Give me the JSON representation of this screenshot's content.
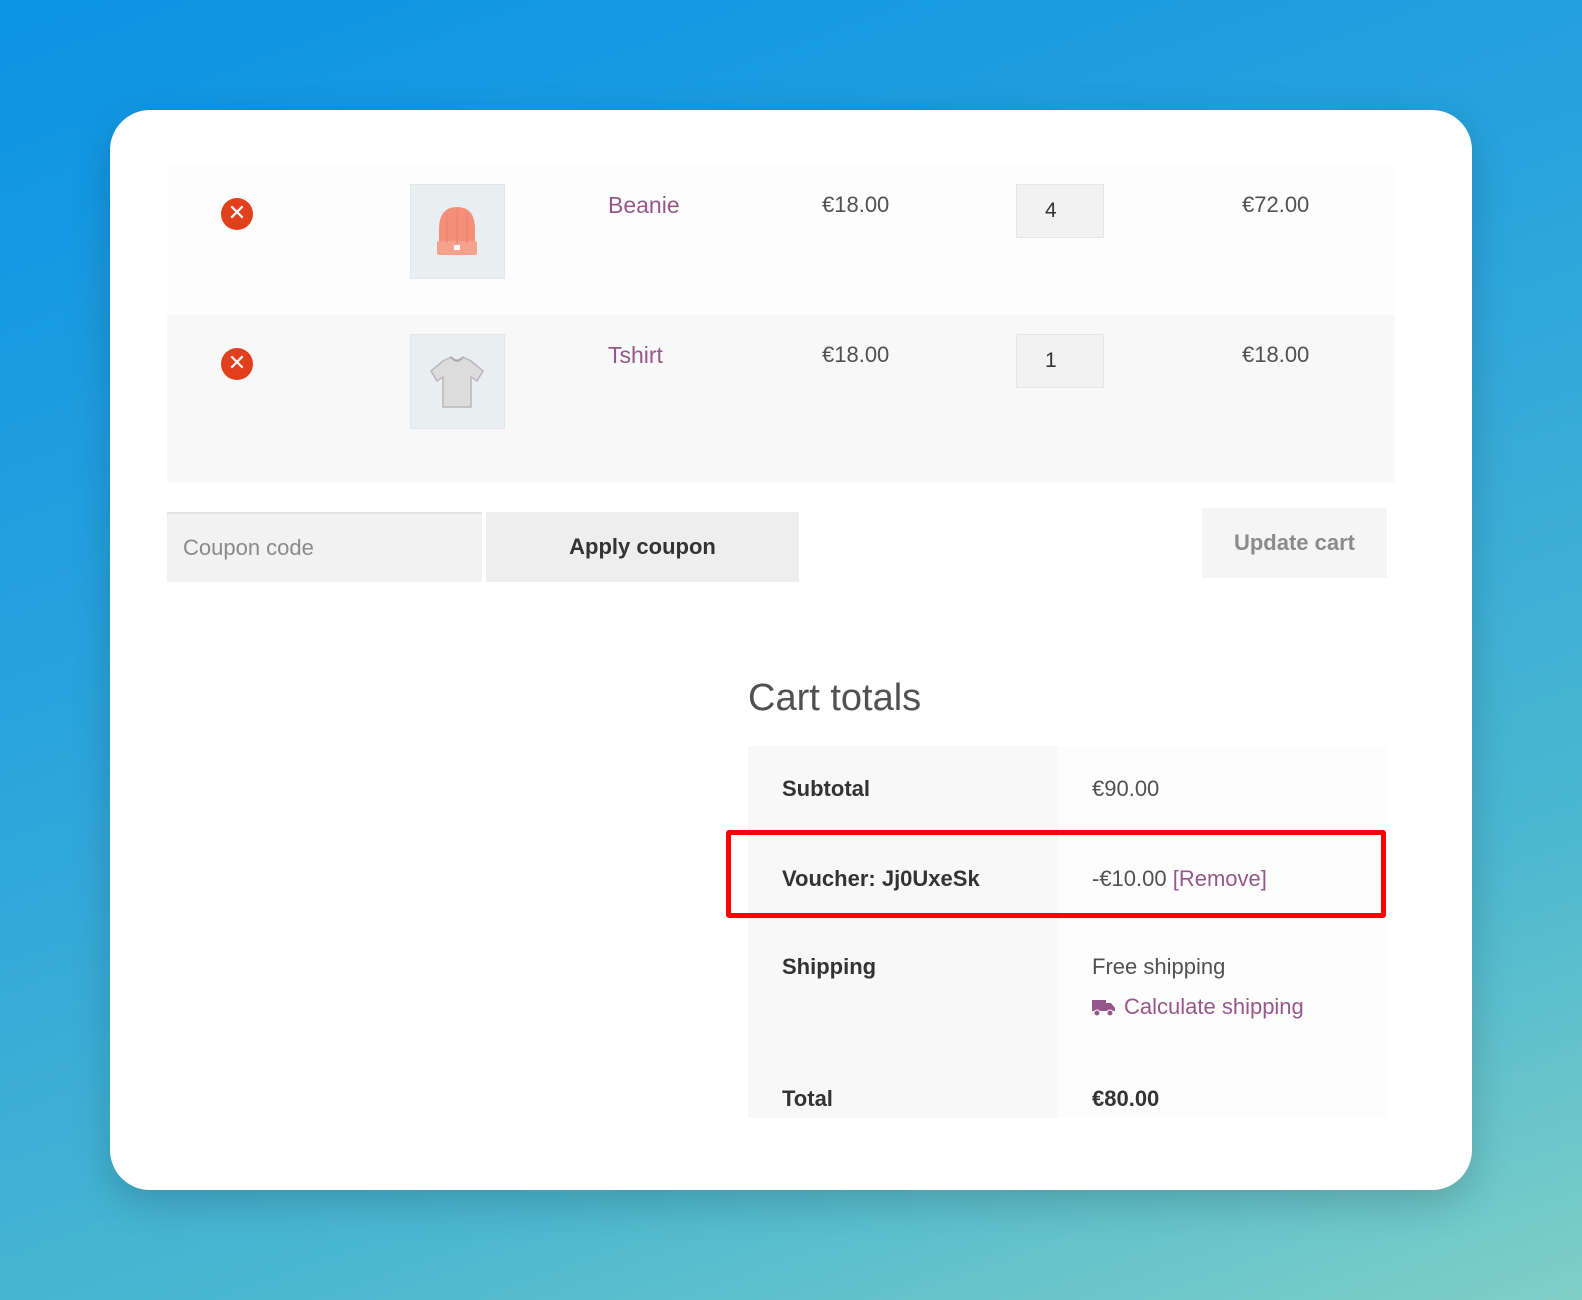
{
  "cart": {
    "items": [
      {
        "name": "Beanie",
        "price": "€18.00",
        "quantity": "4",
        "subtotal": "€72.00",
        "image_icon": "beanie-image"
      },
      {
        "name": "Tshirt",
        "price": "€18.00",
        "quantity": "1",
        "subtotal": "€18.00",
        "image_icon": "tshirt-image"
      }
    ],
    "coupon_placeholder": "Coupon code",
    "apply_coupon_label": "Apply coupon",
    "update_cart_label": "Update cart",
    "remove_glyph": "✕"
  },
  "totals": {
    "title": "Cart totals",
    "subtotal_label": "Subtotal",
    "subtotal_value": "€90.00",
    "voucher_label": "Voucher: Jj0UxeSk",
    "voucher_value": "-€10.00",
    "voucher_remove": "[Remove]",
    "shipping_label": "Shipping",
    "shipping_value": "Free shipping",
    "calculate_shipping": "Calculate shipping",
    "total_label": "Total",
    "total_value": "€80.00"
  },
  "colors": {
    "link": "#96588a",
    "remove": "#e2401c",
    "highlight": "#ff0000"
  }
}
